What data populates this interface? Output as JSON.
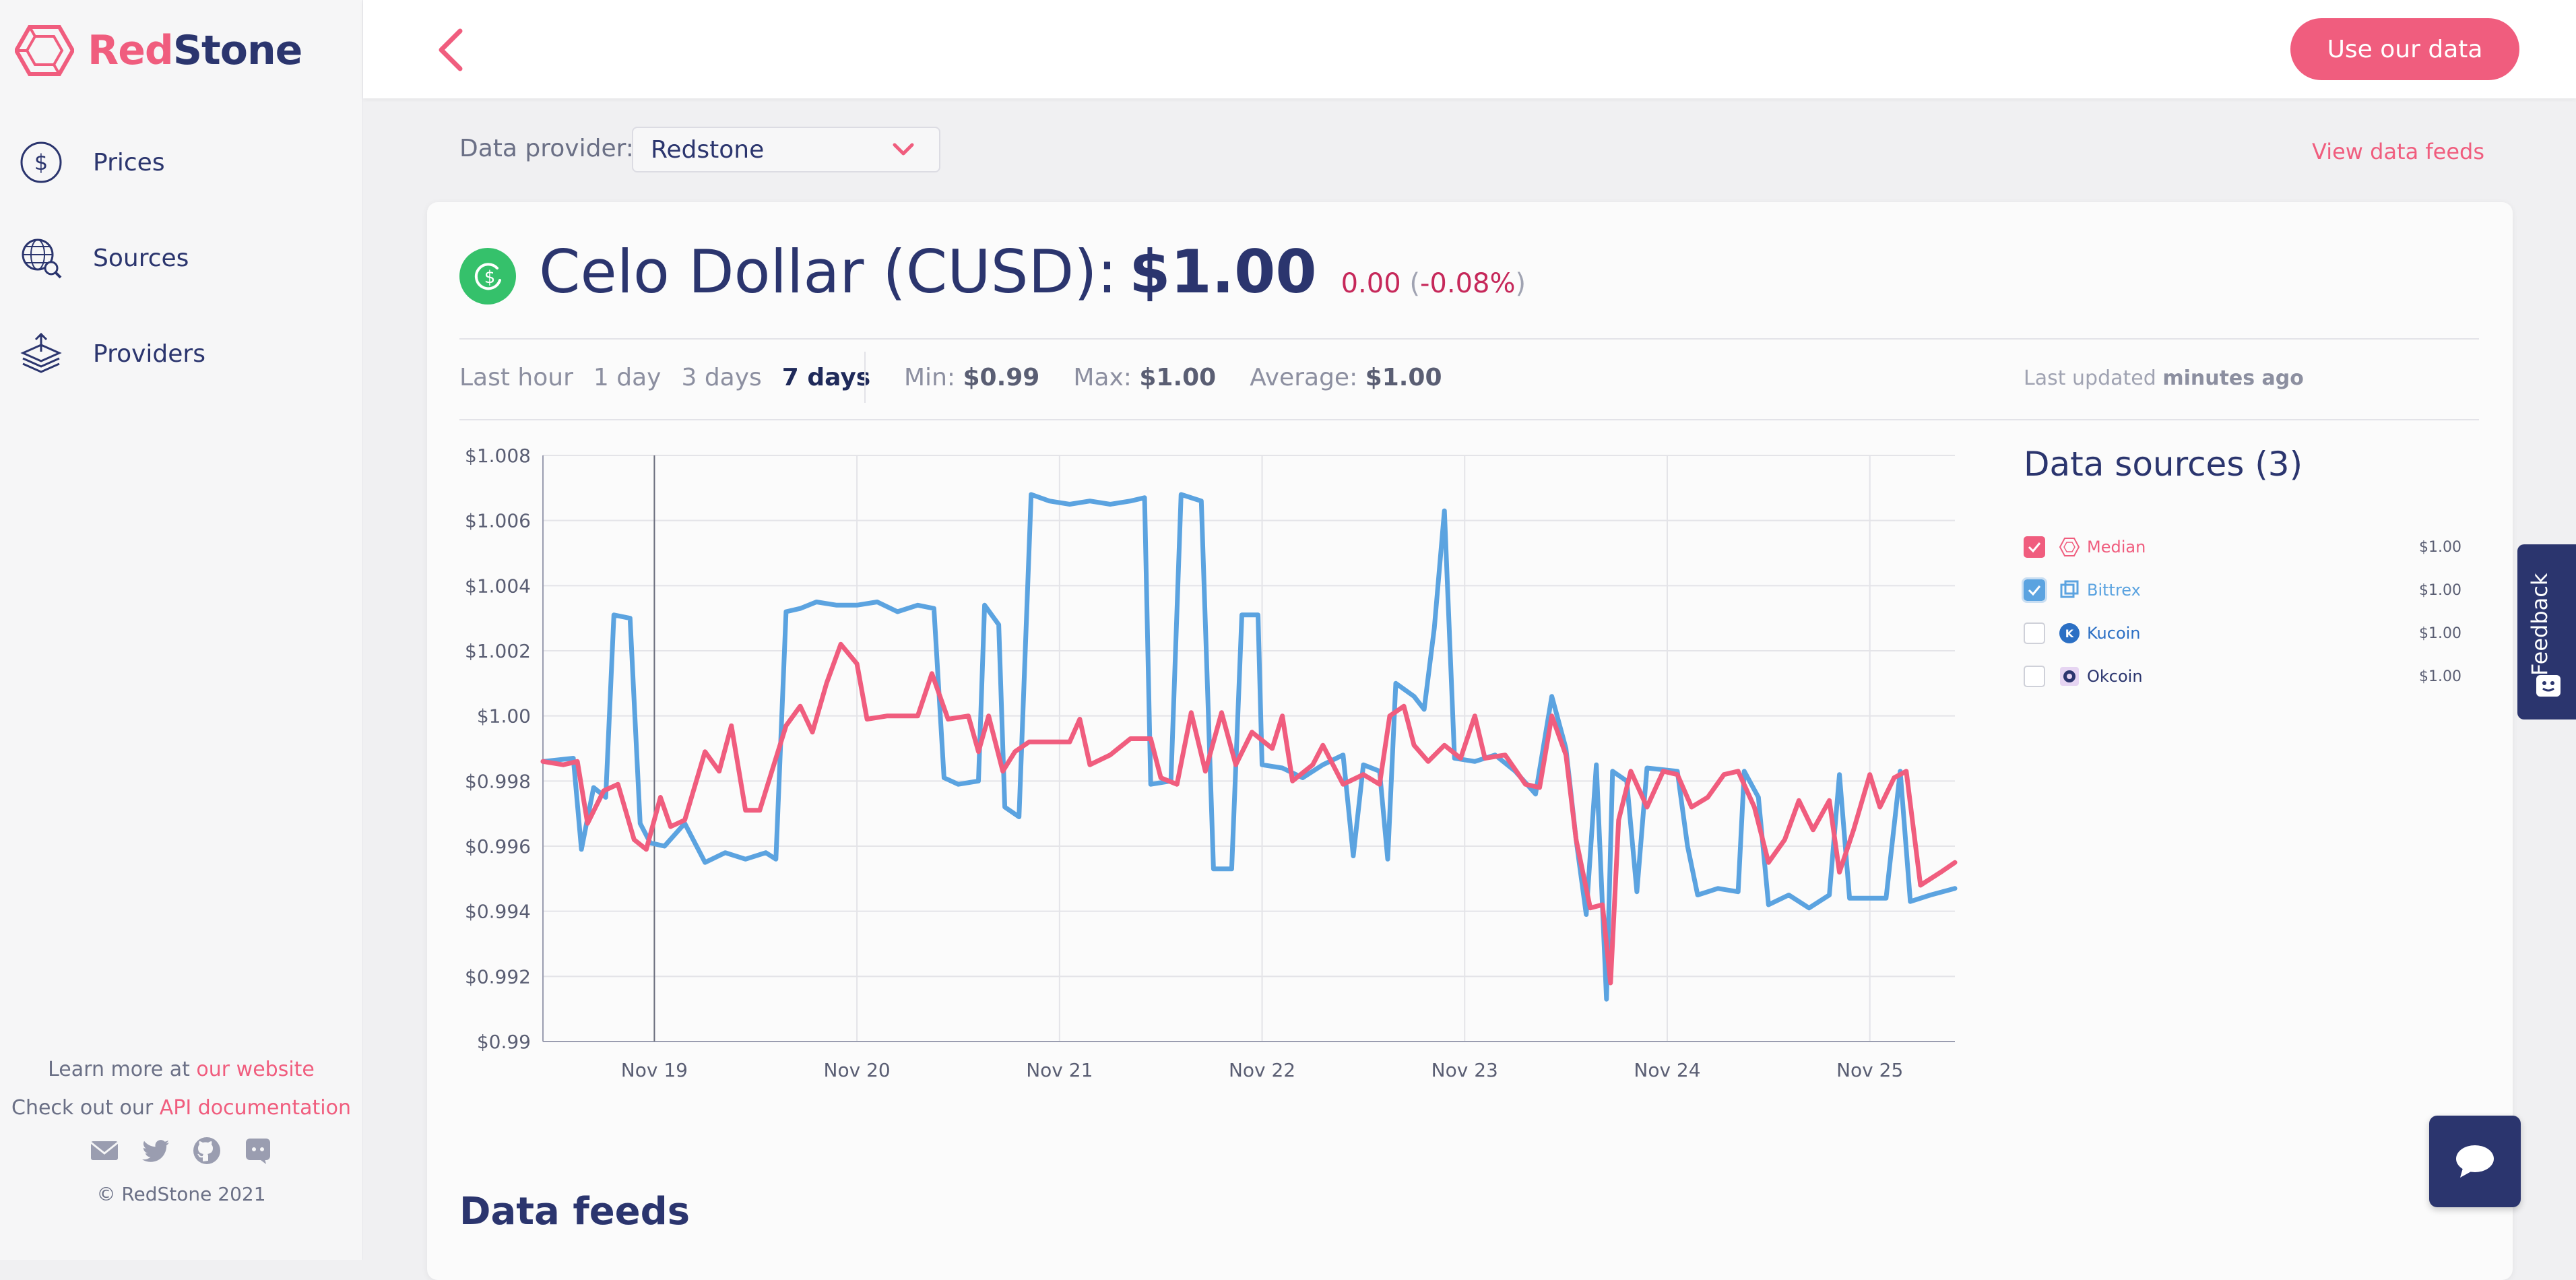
{
  "brand": {
    "name_part1": "Red",
    "name_part2": "Stone",
    "accent": "#f05d7e",
    "navy": "#2b356e"
  },
  "sidebar": {
    "items": [
      {
        "label": "Prices",
        "icon": "dollar-circle-icon"
      },
      {
        "label": "Sources",
        "icon": "globe-search-icon"
      },
      {
        "label": "Providers",
        "icon": "layers-upload-icon"
      }
    ],
    "footer": {
      "learn_prefix": "Learn more at ",
      "learn_link": "our website",
      "api_prefix": "Check out our ",
      "api_link": "API documentation",
      "social_icons": [
        "email-icon",
        "twitter-icon",
        "github-icon",
        "discord-icon"
      ],
      "copyright": "© RedStone 2021"
    }
  },
  "header": {
    "cta_label": "Use our data"
  },
  "provider": {
    "label": "Data provider:",
    "value": "Redstone",
    "view_feeds": "View data feeds"
  },
  "token": {
    "name": "Celo Dollar (CUSD):",
    "price": "$1.00",
    "change_abs": "0.00",
    "change_pct": "-0.08%",
    "paren_open": "(",
    "paren_close": ")"
  },
  "periods": [
    "Last hour",
    "1 day",
    "3 days",
    "7 days"
  ],
  "active_period": "7 days",
  "stats": {
    "min_label": "Min:",
    "min_value": "$0.99",
    "max_label": "Max:",
    "max_value": "$1.00",
    "avg_label": "Average:",
    "avg_value": "$1.00"
  },
  "updated": {
    "label": "Last updated ",
    "value": "minutes ago"
  },
  "data_sources": {
    "title": "Data sources (3)",
    "items": [
      {
        "name": "Median",
        "value": "$1.00",
        "checked": true,
        "color": "#f05d7e",
        "icon": "median-icon"
      },
      {
        "name": "Bittrex",
        "value": "$1.00",
        "checked": true,
        "color": "#5ba3e0",
        "icon": "bittrex-icon"
      },
      {
        "name": "Kucoin",
        "value": "$1.00",
        "checked": false,
        "color": "#2b6fc4",
        "icon": "kucoin-icon"
      },
      {
        "name": "Okcoin",
        "value": "$1.00",
        "checked": false,
        "color": "#2b356e",
        "icon": "okcoin-icon"
      }
    ]
  },
  "feedback_label": "Feedback",
  "feeds_title": "Data feeds",
  "chart_data": {
    "type": "line",
    "title": "",
    "xlabel": "",
    "ylabel": "",
    "ylim": [
      0.99,
      1.008
    ],
    "y_ticks": [
      "$1.008",
      "$1.006",
      "$1.004",
      "$1.002",
      "$1.00",
      "$0.998",
      "$0.996",
      "$0.994",
      "$0.992",
      "$0.99"
    ],
    "y_tick_values": [
      1.008,
      1.006,
      1.004,
      1.002,
      1.0,
      0.998,
      0.996,
      0.994,
      0.992,
      0.99
    ],
    "x_range": [
      18.45,
      25.42
    ],
    "x_ticks": [
      {
        "label": "Nov 19",
        "day": 19
      },
      {
        "label": "Nov 20",
        "day": 20
      },
      {
        "label": "Nov 21",
        "day": 21
      },
      {
        "label": "Nov 22",
        "day": 22
      },
      {
        "label": "Nov 23",
        "day": 23
      },
      {
        "label": "Nov 24",
        "day": 24
      },
      {
        "label": "Nov 25",
        "day": 25
      }
    ],
    "grid": true,
    "series": [
      {
        "color": "#5ba3e0",
        "points": [
          [
            18.45,
            0.9986
          ],
          [
            18.6,
            0.9987
          ],
          [
            18.64,
            0.9959
          ],
          [
            18.7,
            0.9978
          ],
          [
            18.76,
            0.9975
          ],
          [
            18.8,
            1.0031
          ],
          [
            18.88,
            1.003
          ],
          [
            18.93,
            0.9967
          ],
          [
            18.98,
            0.9961
          ],
          [
            19.05,
            0.996
          ],
          [
            19.15,
            0.9967
          ],
          [
            19.25,
            0.9955
          ],
          [
            19.35,
            0.9958
          ],
          [
            19.45,
            0.9956
          ],
          [
            19.55,
            0.9958
          ],
          [
            19.6,
            0.9956
          ],
          [
            19.65,
            1.0032
          ],
          [
            19.72,
            1.0033
          ],
          [
            19.8,
            1.0035
          ],
          [
            19.9,
            1.0034
          ],
          [
            20.0,
            1.0034
          ],
          [
            20.1,
            1.0035
          ],
          [
            20.2,
            1.0032
          ],
          [
            20.3,
            1.0034
          ],
          [
            20.38,
            1.0033
          ],
          [
            20.43,
            0.9981
          ],
          [
            20.5,
            0.9979
          ],
          [
            20.6,
            0.998
          ],
          [
            20.63,
            1.0034
          ],
          [
            20.7,
            1.0028
          ],
          [
            20.73,
            0.9972
          ],
          [
            20.8,
            0.9969
          ],
          [
            20.86,
            1.0068
          ],
          [
            20.95,
            1.0066
          ],
          [
            21.05,
            1.0065
          ],
          [
            21.15,
            1.0066
          ],
          [
            21.25,
            1.0065
          ],
          [
            21.35,
            1.0066
          ],
          [
            21.42,
            1.0067
          ],
          [
            21.45,
            0.9979
          ],
          [
            21.55,
            0.998
          ],
          [
            21.6,
            1.0068
          ],
          [
            21.7,
            1.0066
          ],
          [
            21.76,
            0.9953
          ],
          [
            21.85,
            0.9953
          ],
          [
            21.9,
            1.0031
          ],
          [
            21.98,
            1.0031
          ],
          [
            22.0,
            0.9985
          ],
          [
            22.1,
            0.9984
          ],
          [
            22.2,
            0.9981
          ],
          [
            22.3,
            0.9985
          ],
          [
            22.4,
            0.9988
          ],
          [
            22.45,
            0.9957
          ],
          [
            22.5,
            0.9985
          ],
          [
            22.58,
            0.9983
          ],
          [
            22.62,
            0.9956
          ],
          [
            22.66,
            1.001
          ],
          [
            22.75,
            1.0006
          ],
          [
            22.8,
            1.0002
          ],
          [
            22.85,
            1.0027
          ],
          [
            22.9,
            1.0063
          ],
          [
            22.95,
            0.9987
          ],
          [
            23.05,
            0.9986
          ],
          [
            23.15,
            0.9988
          ],
          [
            23.25,
            0.9983
          ],
          [
            23.35,
            0.9976
          ],
          [
            23.43,
            1.0006
          ],
          [
            23.5,
            0.999
          ],
          [
            23.55,
            0.9962
          ],
          [
            23.6,
            0.9939
          ],
          [
            23.65,
            0.9985
          ],
          [
            23.7,
            0.9913
          ],
          [
            23.73,
            0.9983
          ],
          [
            23.8,
            0.998
          ],
          [
            23.85,
            0.9946
          ],
          [
            23.9,
            0.9984
          ],
          [
            24.05,
            0.9983
          ],
          [
            24.1,
            0.996
          ],
          [
            24.15,
            0.9945
          ],
          [
            24.25,
            0.9947
          ],
          [
            24.35,
            0.9946
          ],
          [
            24.38,
            0.9983
          ],
          [
            24.45,
            0.9975
          ],
          [
            24.5,
            0.9942
          ],
          [
            24.6,
            0.9945
          ],
          [
            24.7,
            0.9941
          ],
          [
            24.8,
            0.9945
          ],
          [
            24.85,
            0.9982
          ],
          [
            24.9,
            0.9944
          ],
          [
            25.0,
            0.9944
          ],
          [
            25.08,
            0.9944
          ],
          [
            25.15,
            0.9983
          ],
          [
            25.2,
            0.9943
          ],
          [
            25.3,
            0.9945
          ],
          [
            25.42,
            0.9947
          ]
        ]
      },
      {
        "color": "#f05d7e",
        "points": [
          [
            18.45,
            0.9986
          ],
          [
            18.55,
            0.9985
          ],
          [
            18.62,
            0.9986
          ],
          [
            18.67,
            0.9967
          ],
          [
            18.75,
            0.9977
          ],
          [
            18.82,
            0.9979
          ],
          [
            18.9,
            0.9962
          ],
          [
            18.96,
            0.9959
          ],
          [
            19.03,
            0.9975
          ],
          [
            19.08,
            0.9966
          ],
          [
            19.15,
            0.9968
          ],
          [
            19.25,
            0.9989
          ],
          [
            19.32,
            0.9983
          ],
          [
            19.38,
            0.9997
          ],
          [
            19.45,
            0.9971
          ],
          [
            19.52,
            0.9971
          ],
          [
            19.58,
            0.9983
          ],
          [
            19.65,
            0.9997
          ],
          [
            19.72,
            1.0003
          ],
          [
            19.78,
            0.9995
          ],
          [
            19.85,
            1.001
          ],
          [
            19.92,
            1.0022
          ],
          [
            20.0,
            1.0016
          ],
          [
            20.05,
            0.9999
          ],
          [
            20.15,
            1.0
          ],
          [
            20.25,
            1.0
          ],
          [
            20.3,
            1.0
          ],
          [
            20.37,
            1.0013
          ],
          [
            20.45,
            0.9999
          ],
          [
            20.55,
            1.0
          ],
          [
            20.6,
            0.9989
          ],
          [
            20.65,
            1.0
          ],
          [
            20.72,
            0.9983
          ],
          [
            20.78,
            0.9989
          ],
          [
            20.85,
            0.9992
          ],
          [
            20.95,
            0.9992
          ],
          [
            21.05,
            0.9992
          ],
          [
            21.1,
            0.9999
          ],
          [
            21.15,
            0.9985
          ],
          [
            21.25,
            0.9988
          ],
          [
            21.35,
            0.9993
          ],
          [
            21.45,
            0.9993
          ],
          [
            21.5,
            0.9981
          ],
          [
            21.58,
            0.9979
          ],
          [
            21.65,
            1.0001
          ],
          [
            21.72,
            0.9983
          ],
          [
            21.8,
            1.0001
          ],
          [
            21.87,
            0.9985
          ],
          [
            21.95,
            0.9995
          ],
          [
            22.05,
            0.999
          ],
          [
            22.1,
            1.0
          ],
          [
            22.15,
            0.998
          ],
          [
            22.25,
            0.9985
          ],
          [
            22.3,
            0.9991
          ],
          [
            22.4,
            0.9979
          ],
          [
            22.5,
            0.9982
          ],
          [
            22.58,
            0.9979
          ],
          [
            22.63,
            1.0
          ],
          [
            22.7,
            1.0003
          ],
          [
            22.75,
            0.9991
          ],
          [
            22.82,
            0.9986
          ],
          [
            22.9,
            0.9991
          ],
          [
            22.98,
            0.9987
          ],
          [
            23.05,
            1.0
          ],
          [
            23.1,
            0.9987
          ],
          [
            23.2,
            0.9988
          ],
          [
            23.3,
            0.9979
          ],
          [
            23.37,
            0.9978
          ],
          [
            23.43,
            1.0
          ],
          [
            23.5,
            0.9988
          ],
          [
            23.55,
            0.9962
          ],
          [
            23.62,
            0.9941
          ],
          [
            23.68,
            0.9942
          ],
          [
            23.72,
            0.9918
          ],
          [
            23.76,
            0.9968
          ],
          [
            23.82,
            0.9983
          ],
          [
            23.9,
            0.9972
          ],
          [
            23.98,
            0.9983
          ],
          [
            24.05,
            0.9982
          ],
          [
            24.12,
            0.9972
          ],
          [
            24.2,
            0.9975
          ],
          [
            24.28,
            0.9982
          ],
          [
            24.35,
            0.9983
          ],
          [
            24.43,
            0.9972
          ],
          [
            24.5,
            0.9955
          ],
          [
            24.58,
            0.9962
          ],
          [
            24.65,
            0.9974
          ],
          [
            24.72,
            0.9965
          ],
          [
            24.8,
            0.9974
          ],
          [
            24.85,
            0.9952
          ],
          [
            24.92,
            0.9965
          ],
          [
            25.0,
            0.9982
          ],
          [
            25.05,
            0.9972
          ],
          [
            25.12,
            0.9981
          ],
          [
            25.18,
            0.9983
          ],
          [
            25.25,
            0.9948
          ],
          [
            25.35,
            0.9952
          ],
          [
            25.42,
            0.9955
          ]
        ]
      }
    ]
  }
}
